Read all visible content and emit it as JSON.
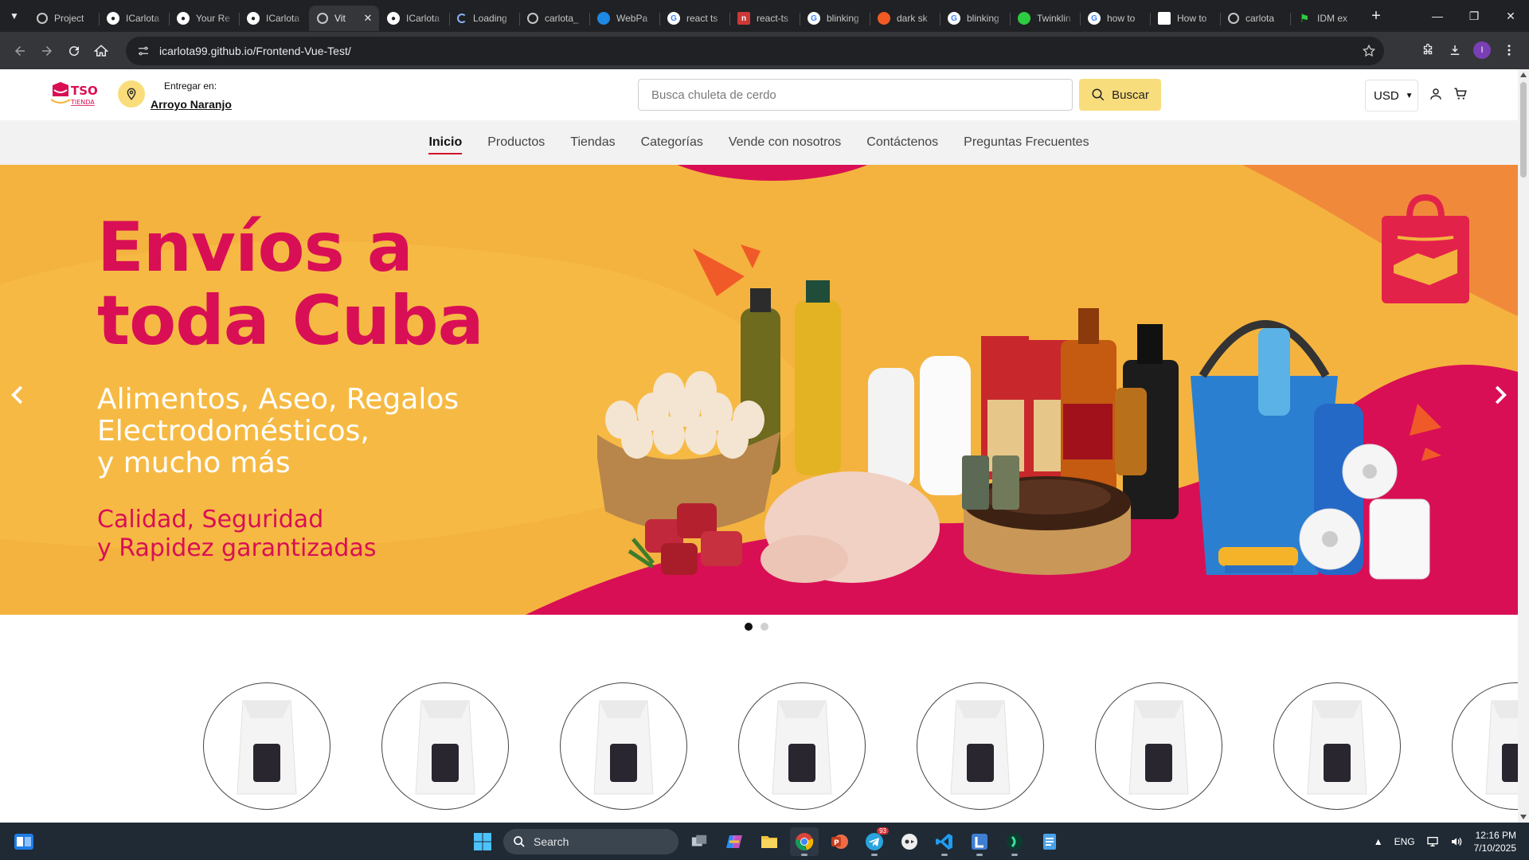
{
  "browser": {
    "tabs": [
      {
        "title": "Project",
        "favicon": "globe-icon",
        "color": "#ffffff"
      },
      {
        "title": "ICarlota",
        "favicon": "github-icon",
        "color": "#ffffff"
      },
      {
        "title": "Your Re",
        "favicon": "github-icon",
        "color": "#ffffff"
      },
      {
        "title": "ICarlota",
        "favicon": "github-icon",
        "color": "#ffffff"
      },
      {
        "title": "Vit",
        "favicon": "globe-icon",
        "color": "#ffffff",
        "active": true
      },
      {
        "title": "ICarlota",
        "favicon": "github-icon",
        "color": "#ffffff"
      },
      {
        "title": "Loading",
        "favicon": "spinner-icon",
        "color": "#ffffff"
      },
      {
        "title": "carlota_",
        "favicon": "globe-icon",
        "color": "#ffffff"
      },
      {
        "title": "WebPa",
        "favicon": "webpage-icon",
        "color": "#1e88e5"
      },
      {
        "title": "react ts",
        "favicon": "google-icon",
        "color": "#ffffff"
      },
      {
        "title": "react-ts",
        "favicon": "npm-icon",
        "color": "#cb3837"
      },
      {
        "title": "blinking",
        "favicon": "google-icon",
        "color": "#ffffff"
      },
      {
        "title": "dark sk",
        "favicon": "brave-icon",
        "color": "#f15a22"
      },
      {
        "title": "blinking",
        "favicon": "google-icon",
        "color": "#ffffff"
      },
      {
        "title": "Twinklin",
        "favicon": "twinkle-icon",
        "color": "#2ecc40"
      },
      {
        "title": "how to",
        "favicon": "google-icon",
        "color": "#ffffff"
      },
      {
        "title": "How to",
        "favicon": "doc-icon",
        "color": "#ffffff"
      },
      {
        "title": "carlota",
        "favicon": "globe-icon",
        "color": "#ffffff"
      },
      {
        "title": "IDM ex",
        "favicon": "flag-icon",
        "color": "#2ecc40"
      }
    ],
    "url": "icarlota99.github.io/Frontend-Vue-Test/",
    "profile_initial": "I"
  },
  "site": {
    "logo_text": "TSO",
    "logo_sub": "TIENDA",
    "delivery_label": "Entregar en:",
    "delivery_location": "Arroyo Naranjo",
    "search_placeholder": "Busca chuleta de cerdo",
    "search_button": "Buscar",
    "currency": "USD",
    "nav": [
      {
        "label": "Inicio",
        "active": true
      },
      {
        "label": "Productos"
      },
      {
        "label": "Tiendas"
      },
      {
        "label": "Categorías"
      },
      {
        "label": "Vende con nosotros"
      },
      {
        "label": "Contáctenos"
      },
      {
        "label": "Preguntas Frecuentes"
      }
    ],
    "hero": {
      "title_line1": "Envíos a",
      "title_line2": "toda Cuba",
      "subtitle_line1": "Alimentos, Aseo, Regalos",
      "subtitle_line2": "Electrodomésticos,",
      "subtitle_line3": "y mucho más",
      "tagline_line1": "Calidad, Seguridad",
      "tagline_line2": "y Rapidez garantizadas",
      "slide_current": 1,
      "slide_count": 2
    },
    "colors": {
      "brand_red": "#d90f55",
      "hero_orange": "#f4b33f",
      "search_yellow": "#f8dd7d"
    }
  },
  "taskbar": {
    "search_label": "Search",
    "language": "ENG",
    "time": "12:16 PM",
    "date": "7/10/2025",
    "telegram_badge": "93"
  }
}
